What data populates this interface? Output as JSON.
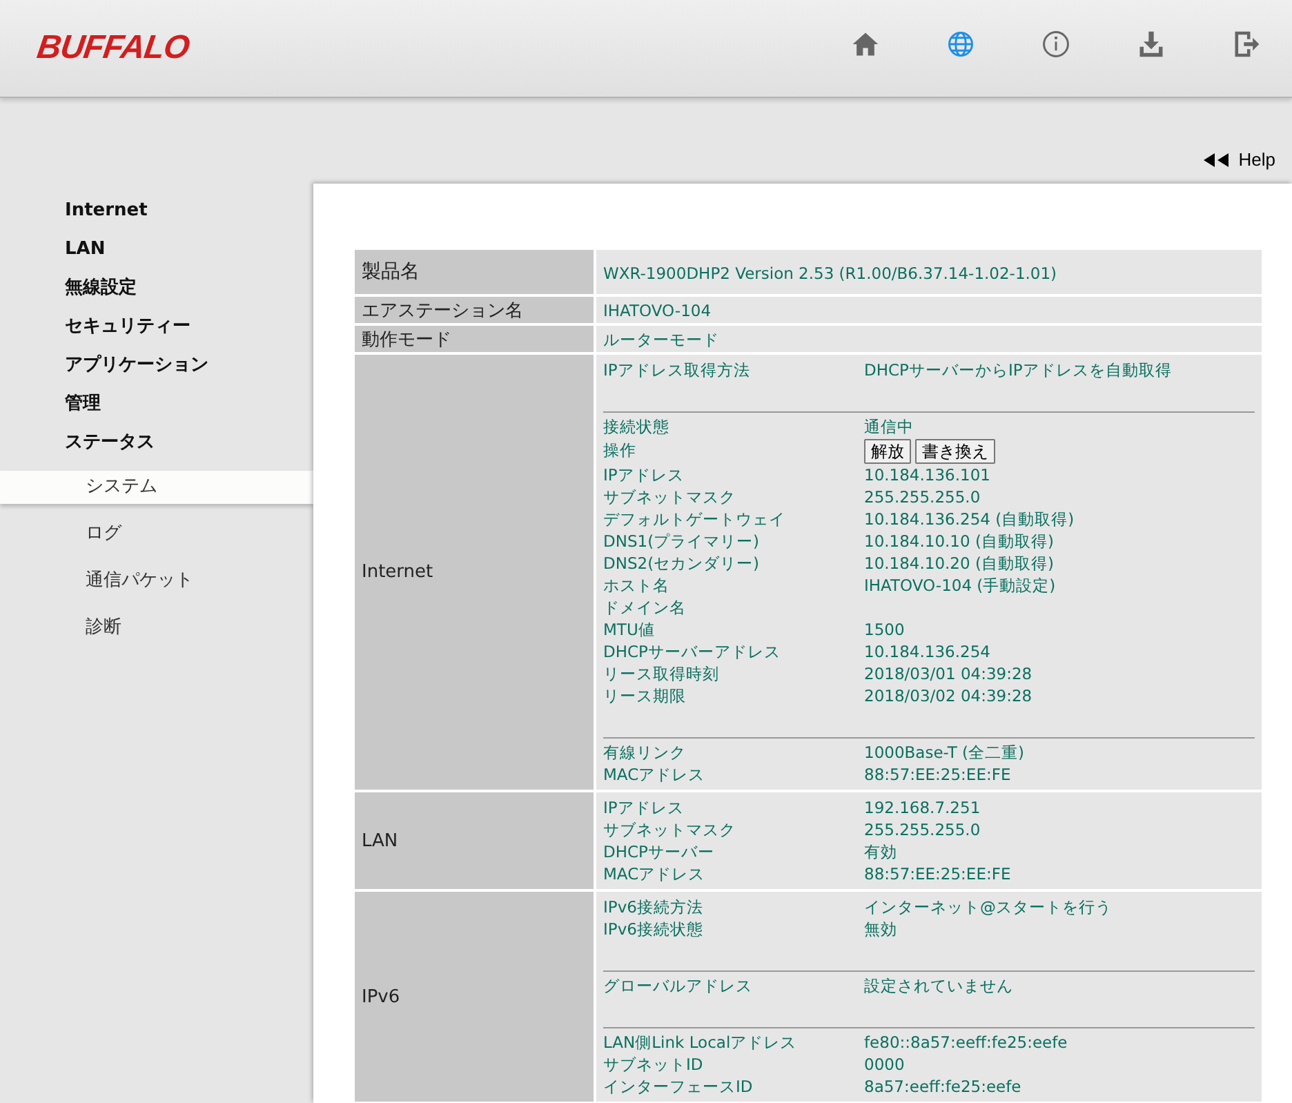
{
  "header": {
    "logo": "BUFFALO",
    "icons": [
      {
        "kind": "home",
        "selected": false
      },
      {
        "kind": "globe",
        "selected": true
      },
      {
        "kind": "info",
        "selected": false
      },
      {
        "kind": "download",
        "selected": false
      },
      {
        "kind": "logout",
        "selected": false
      }
    ]
  },
  "help": {
    "label": "Help"
  },
  "sidebar": {
    "items": [
      {
        "label": "Internet",
        "selected": false
      },
      {
        "label": "LAN",
        "selected": false
      },
      {
        "label": "無線設定",
        "selected": false
      },
      {
        "label": "セキュリティー",
        "selected": false
      },
      {
        "label": "アプリケーション",
        "selected": false
      },
      {
        "label": "管理",
        "selected": false
      },
      {
        "label": "ステータス",
        "selected": false,
        "children": [
          {
            "label": "システム",
            "selected": true
          },
          {
            "label": "ログ",
            "selected": false
          },
          {
            "label": "通信パケット",
            "selected": false
          },
          {
            "label": "診断",
            "selected": false
          }
        ]
      }
    ]
  },
  "table": {
    "sections": [
      {
        "kind": "simple",
        "label": "製品名",
        "value": "WXR-1900DHP2  Version 2.53 (R1.00/B6.37.14-1.02-1.01)"
      },
      {
        "kind": "simple",
        "label": "エアステーション名",
        "value": "IHATOVO-104"
      },
      {
        "kind": "simple",
        "label": "動作モード",
        "value": "ルーターモード"
      },
      {
        "kind": "grouped",
        "label": "Internet",
        "groups": [
          [
            {
              "kind": "text",
              "label": "IPアドレス取得方法",
              "value": "DHCPサーバーからIPアドレスを自動取得"
            }
          ],
          [
            {
              "kind": "text",
              "label": "接続状態",
              "value": "通信中"
            },
            {
              "kind": "buttons",
              "label": "操作",
              "buttons": [
                "解放",
                "書き換え"
              ]
            },
            {
              "kind": "text",
              "label": "IPアドレス",
              "value": "10.184.136.101"
            },
            {
              "kind": "text",
              "label": "サブネットマスク",
              "value": "255.255.255.0"
            },
            {
              "kind": "text",
              "label": "デフォルトゲートウェイ",
              "value": "10.184.136.254 (自動取得)"
            },
            {
              "kind": "text",
              "label": "DNS1(プライマリー)",
              "value": "10.184.10.10 (自動取得)"
            },
            {
              "kind": "text",
              "label": "DNS2(セカンダリー)",
              "value": "10.184.10.20 (自動取得)"
            },
            {
              "kind": "text",
              "label": "ホスト名",
              "value": "IHATOVO-104 (手動設定)"
            },
            {
              "kind": "text",
              "label": "ドメイン名"
            },
            {
              "kind": "text",
              "label": "MTU値",
              "value": "1500"
            },
            {
              "kind": "text",
              "label": "DHCPサーバーアドレス",
              "value": "10.184.136.254"
            },
            {
              "kind": "text",
              "label": "リース取得時刻",
              "value": "2018/03/01 04:39:28"
            },
            {
              "kind": "text",
              "label": "リース期限",
              "value": "2018/03/02 04:39:28"
            }
          ],
          [
            {
              "kind": "text",
              "label": "有線リンク",
              "value": "1000Base-T (全二重)"
            },
            {
              "kind": "text",
              "label": "MACアドレス",
              "value": "88:57:EE:25:EE:FE"
            }
          ]
        ]
      },
      {
        "kind": "grouped",
        "label": "LAN",
        "groups": [
          [
            {
              "kind": "text",
              "label": "IPアドレス",
              "value": "192.168.7.251"
            },
            {
              "kind": "text",
              "label": "サブネットマスク",
              "value": "255.255.255.0"
            },
            {
              "kind": "text",
              "label": "DHCPサーバー",
              "value": "有効"
            },
            {
              "kind": "text",
              "label": "MACアドレス",
              "value": "88:57:EE:25:EE:FE"
            }
          ]
        ]
      },
      {
        "kind": "grouped",
        "label": "IPv6",
        "groups": [
          [
            {
              "kind": "text",
              "label": "IPv6接続方法",
              "value": "インターネット@スタートを行う"
            },
            {
              "kind": "text",
              "label": "IPv6接続状態",
              "value": "無効"
            }
          ],
          [
            {
              "kind": "text",
              "label": "グローバルアドレス",
              "value": "設定されていません"
            }
          ],
          [
            {
              "kind": "text",
              "label": "LAN側Link Localアドレス",
              "value": "fe80::8a57:eeff:fe25:eefe"
            },
            {
              "kind": "text",
              "label": "サブネットID",
              "value": "0000"
            },
            {
              "kind": "text",
              "label": "インターフェースID",
              "value": "8a57:eeff:fe25:eefe"
            }
          ]
        ]
      }
    ]
  }
}
